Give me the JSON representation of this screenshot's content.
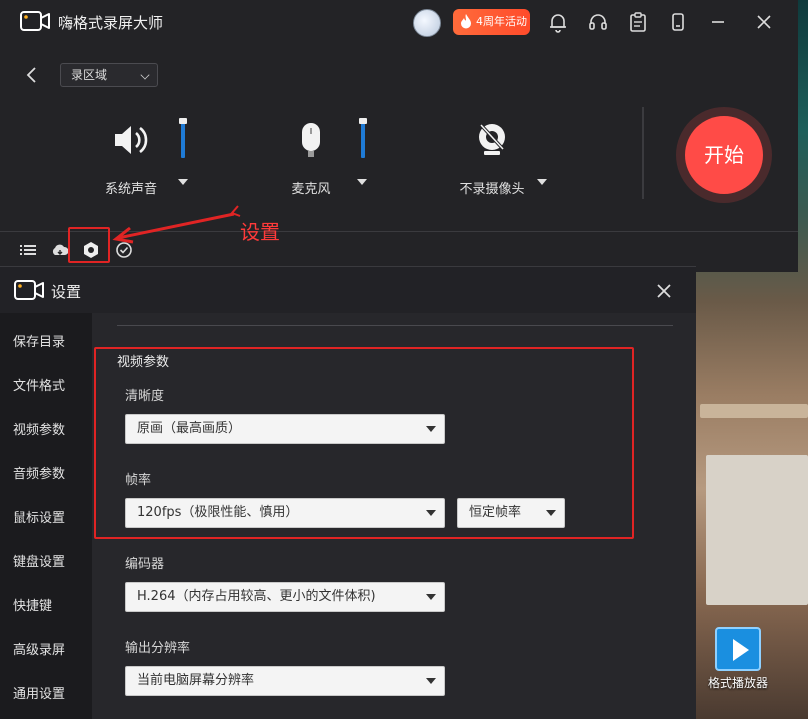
{
  "app": {
    "title": "嗨格式录屏大师",
    "promo_label": "4周年活动",
    "mode_select": "录区域",
    "sources": [
      {
        "label": "系统声音",
        "icon": "speaker-icon"
      },
      {
        "label": "麦克风",
        "icon": "microphone-icon"
      },
      {
        "label": "不录摄像头",
        "icon": "camera-off-icon"
      }
    ],
    "start_label": "开始"
  },
  "annotation": {
    "label": "设置"
  },
  "settings": {
    "title": "设置",
    "sidebar": [
      "保存目录",
      "文件格式",
      "视频参数",
      "音频参数",
      "鼠标设置",
      "键盘设置",
      "快捷键",
      "高级录屏",
      "通用设置"
    ],
    "section_title": "视频参数",
    "clarity_label": "清晰度",
    "clarity_value": "原画（最高画质）",
    "framerate_label": "帧率",
    "framerate_value": "120fps（极限性能、慎用）",
    "framerate_mode": "恒定帧率",
    "encoder_label": "编码器",
    "encoder_value": "H.264（内存占用较高、更小的文件体积)",
    "resolution_label": "输出分辨率",
    "resolution_value": "当前电脑屏幕分辨率"
  },
  "desktop": {
    "icon_label": "格式播放器"
  },
  "colors": {
    "accent_red": "#ff4b47",
    "slider_blue": "#1f7bd6",
    "annotation_red": "#e02424"
  }
}
